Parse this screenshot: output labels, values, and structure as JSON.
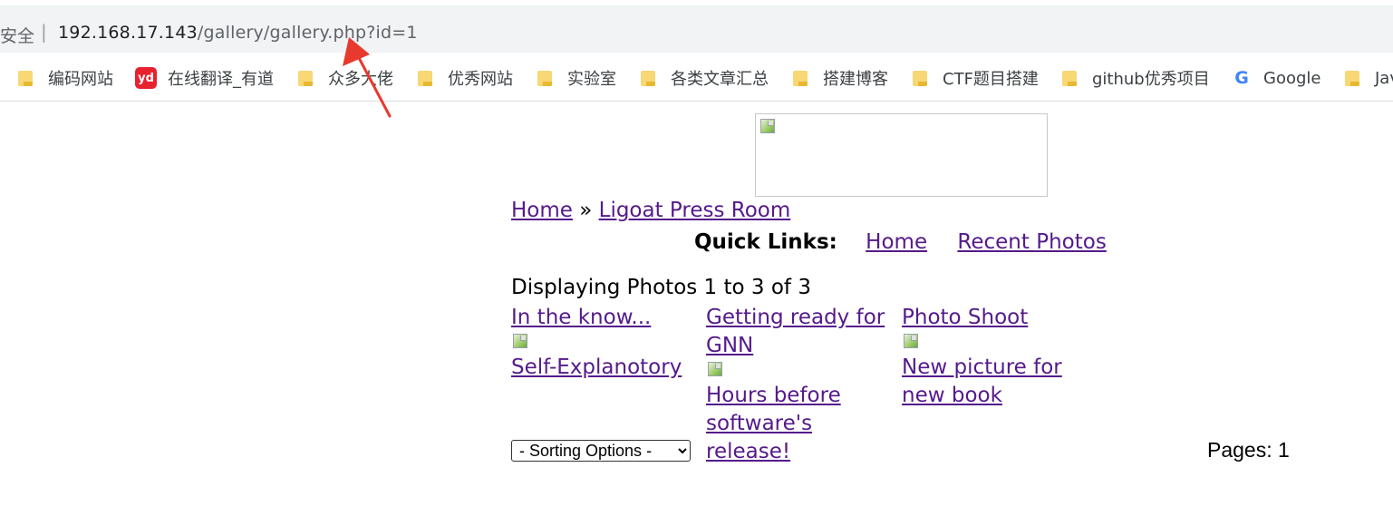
{
  "browser": {
    "security_label": "安全",
    "separator": "|",
    "url_host": "192.168.17.143",
    "url_path": "/gallery/gallery.php?id=1"
  },
  "bookmarks": [
    {
      "label": "编码网站",
      "icon": "folder-icon"
    },
    {
      "label": "在线翻译_有道",
      "icon": "youdao-icon",
      "icon_text": "yd"
    },
    {
      "label": "众多大佬",
      "icon": "folder-icon"
    },
    {
      "label": "优秀网站",
      "icon": "folder-icon"
    },
    {
      "label": "实验室",
      "icon": "folder-icon"
    },
    {
      "label": "各类文章汇总",
      "icon": "folder-icon"
    },
    {
      "label": "搭建博客",
      "icon": "folder-icon"
    },
    {
      "label": "CTF题目搭建",
      "icon": "folder-icon"
    },
    {
      "label": "github优秀项目",
      "icon": "folder-icon"
    },
    {
      "label": "Google",
      "icon": "google-icon",
      "icon_text": "G"
    },
    {
      "label": "Jav",
      "icon": "folder-icon"
    }
  ],
  "page": {
    "breadcrumb": {
      "home": "Home",
      "separator": "»",
      "current": "Ligoat Press Room"
    },
    "quick_links": {
      "label": "Quick Links:",
      "home": "Home",
      "recent": "Recent Photos"
    },
    "displaying": "Displaying Photos 1 to 3 of 3",
    "photos": [
      {
        "title": "In the know...",
        "caption": "Self-Explanotory"
      },
      {
        "title": "Getting ready for GNN",
        "caption": "Hours before software's release!"
      },
      {
        "title": "Photo Shoot",
        "caption": "New picture for new book"
      }
    ],
    "sorting": {
      "selected": "- Sorting Options -"
    },
    "pages": "Pages: 1"
  },
  "colors": {
    "link_visited": "#551a8b",
    "annotation_arrow": "#e8392f"
  }
}
